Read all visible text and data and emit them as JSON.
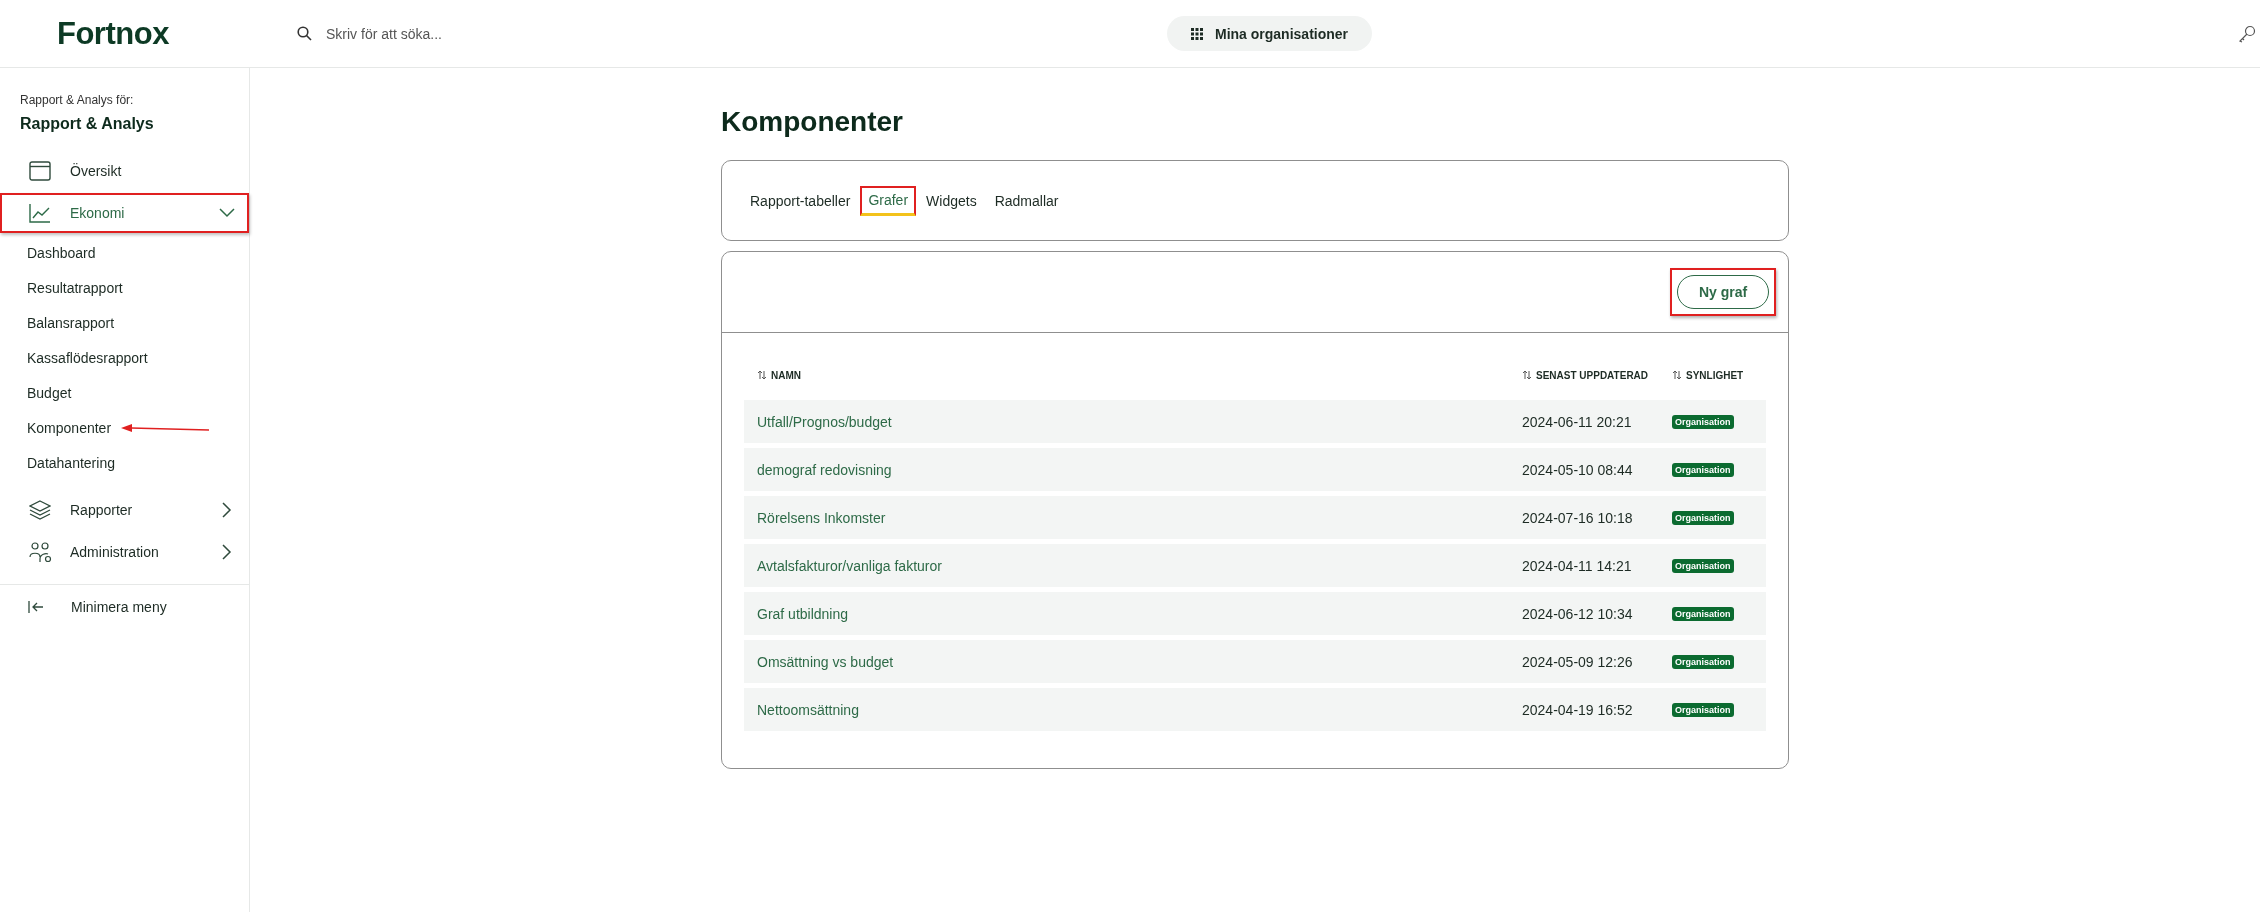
{
  "header": {
    "logo": "Fortnox",
    "search": {
      "placeholder": "Skriv för att söka..."
    },
    "org_button": "Mina organisationer"
  },
  "sidebar": {
    "context_label": "Rapport & Analys för:",
    "context_name": "Rapport & Analys",
    "items": [
      {
        "label": "Översikt",
        "kind": "link",
        "selected": false,
        "highlighted": false
      },
      {
        "label": "Ekonomi",
        "kind": "group",
        "selected": true,
        "highlighted": true,
        "expanded": true,
        "children": [
          {
            "label": "Dashboard",
            "arrow": false
          },
          {
            "label": "Resultatrapport",
            "arrow": false
          },
          {
            "label": "Balansrapport",
            "arrow": false
          },
          {
            "label": "Kassaflödesrapport",
            "arrow": false
          },
          {
            "label": "Budget",
            "arrow": false
          },
          {
            "label": "Komponenter",
            "arrow": true
          },
          {
            "label": "Datahantering",
            "arrow": false
          }
        ]
      },
      {
        "label": "Rapporter",
        "kind": "group",
        "selected": false,
        "highlighted": false,
        "expanded": false
      },
      {
        "label": "Administration",
        "kind": "group",
        "selected": false,
        "highlighted": false,
        "expanded": false
      }
    ],
    "collapse_label": "Minimera meny"
  },
  "page": {
    "title": "Komponenter",
    "tabs": [
      {
        "label": "Rapport-tabeller",
        "selected": false,
        "highlighted": false
      },
      {
        "label": "Grafer",
        "selected": true,
        "highlighted": true
      },
      {
        "label": "Widgets",
        "selected": false,
        "highlighted": false
      },
      {
        "label": "Radmallar",
        "selected": false,
        "highlighted": false
      }
    ],
    "new_button": {
      "label": "Ny graf",
      "highlighted": true
    },
    "table": {
      "columns": [
        {
          "label": "NAMN"
        },
        {
          "label": "SENAST UPPDATERAD"
        },
        {
          "label": "SYNLIGHET"
        }
      ],
      "rows": [
        {
          "name": "Utfall/Prognos/budget",
          "updated": "2024-06-11 20:21",
          "visibility": "Organisation"
        },
        {
          "name": "demograf redovisning",
          "updated": "2024-05-10 08:44",
          "visibility": "Organisation"
        },
        {
          "name": "Rörelsens Inkomster",
          "updated": "2024-07-16 10:18",
          "visibility": "Organisation"
        },
        {
          "name": "Avtalsfakturor/vanliga fakturor",
          "updated": "2024-04-11 14:21",
          "visibility": "Organisation"
        },
        {
          "name": "Graf utbildning",
          "updated": "2024-06-12 10:34",
          "visibility": "Organisation"
        },
        {
          "name": "Omsättning vs budget",
          "updated": "2024-05-09 12:26",
          "visibility": "Organisation"
        },
        {
          "name": "Nettoomsättning",
          "updated": "2024-04-19 16:52",
          "visibility": "Organisation"
        }
      ]
    }
  }
}
